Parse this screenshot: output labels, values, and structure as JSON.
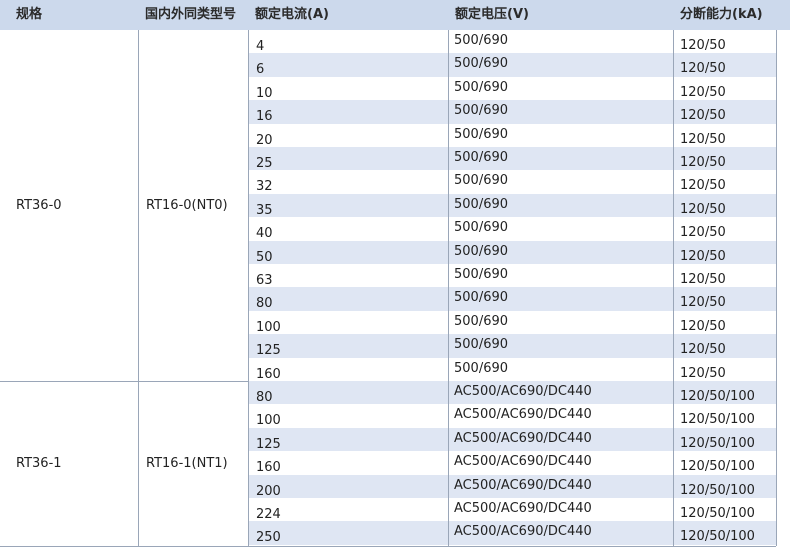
{
  "headers": [
    "规格",
    "国内外同类型号",
    "额定电流(A)",
    "额定电压(V)",
    "分断能力(kA)"
  ],
  "groups": [
    {
      "spec": "RT36-0",
      "model": "RT16-0(NT0)",
      "rows": [
        {
          "current": "4",
          "voltage": "500/690",
          "breaking": "120/50"
        },
        {
          "current": "6",
          "voltage": "500/690",
          "breaking": "120/50"
        },
        {
          "current": "10",
          "voltage": "500/690",
          "breaking": "120/50"
        },
        {
          "current": "16",
          "voltage": "500/690",
          "breaking": "120/50"
        },
        {
          "current": "20",
          "voltage": "500/690",
          "breaking": "120/50"
        },
        {
          "current": "25",
          "voltage": "500/690",
          "breaking": "120/50"
        },
        {
          "current": "32",
          "voltage": "500/690",
          "breaking": "120/50"
        },
        {
          "current": "35",
          "voltage": "500/690",
          "breaking": "120/50"
        },
        {
          "current": "40",
          "voltage": "500/690",
          "breaking": "120/50"
        },
        {
          "current": "50",
          "voltage": "500/690",
          "breaking": "120/50"
        },
        {
          "current": "63",
          "voltage": "500/690",
          "breaking": "120/50"
        },
        {
          "current": "80",
          "voltage": "500/690",
          "breaking": "120/50"
        },
        {
          "current": "100",
          "voltage": "500/690",
          "breaking": "120/50"
        },
        {
          "current": "125",
          "voltage": "500/690",
          "breaking": "120/50"
        },
        {
          "current": "160",
          "voltage": "500/690",
          "breaking": "120/50"
        }
      ]
    },
    {
      "spec": "RT36-1",
      "model": "RT16-1(NT1)",
      "rows": [
        {
          "current": "80",
          "voltage": "AC500/AC690/DC440",
          "breaking": "120/50/100"
        },
        {
          "current": "100",
          "voltage": "AC500/AC690/DC440",
          "breaking": "120/50/100"
        },
        {
          "current": "125",
          "voltage": "AC500/AC690/DC440",
          "breaking": "120/50/100"
        },
        {
          "current": "160",
          "voltage": "AC500/AC690/DC440",
          "breaking": "120/50/100"
        },
        {
          "current": "200",
          "voltage": "AC500/AC690/DC440",
          "breaking": "120/50/100"
        },
        {
          "current": "224",
          "voltage": "AC500/AC690/DC440",
          "breaking": "120/50/100"
        },
        {
          "current": "250",
          "voltage": "AC500/AC690/DC440",
          "breaking": "120/50/100"
        }
      ]
    }
  ]
}
